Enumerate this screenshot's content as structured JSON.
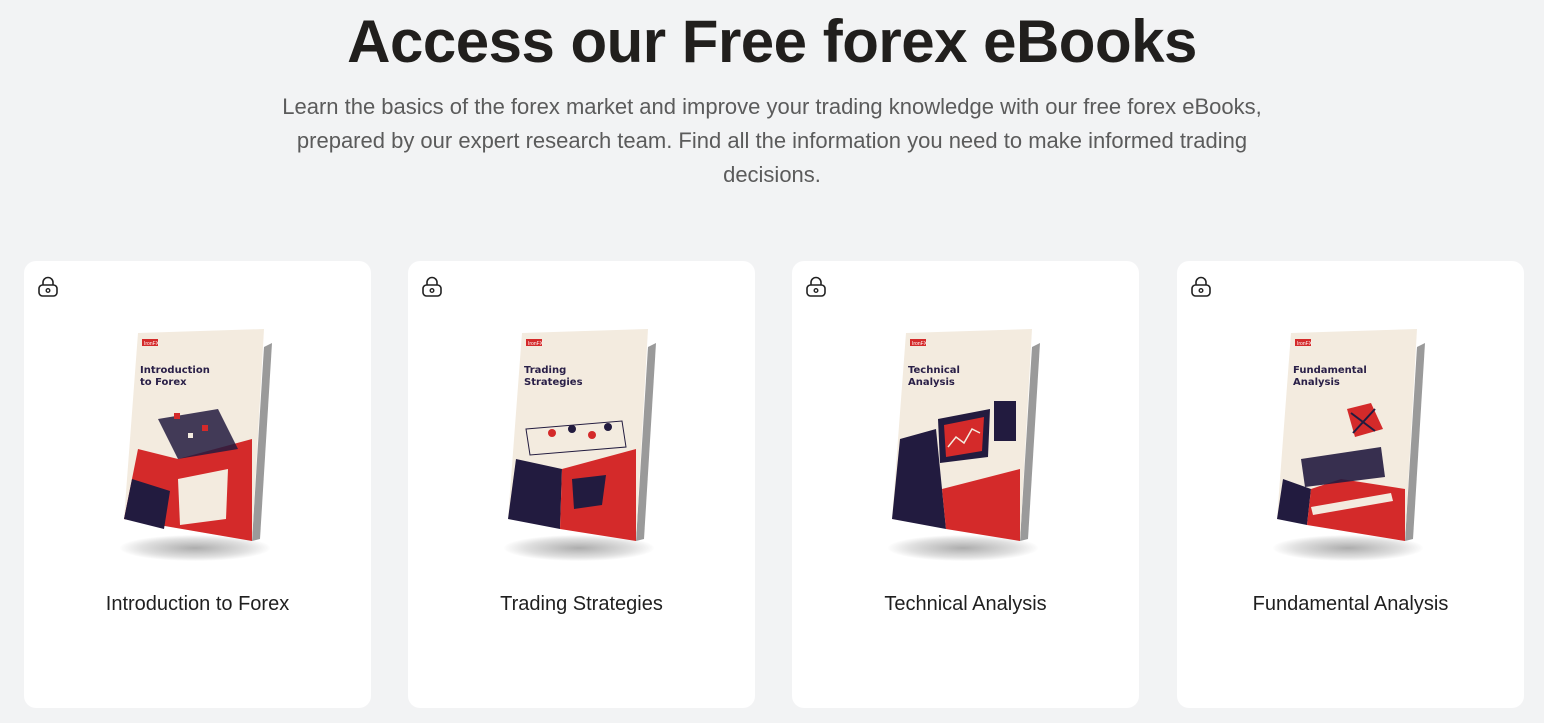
{
  "hero": {
    "title": "Access our Free forex eBooks",
    "subtitle": "Learn the basics of the forex market and improve your trading knowledge with our free forex eBooks, prepared by our expert research team. Find all the information you need to make informed trading decisions."
  },
  "theme": {
    "page_bg": "#f2f3f4",
    "card_bg": "#ffffff",
    "accent_red": "#d42a2a",
    "navy": "#221b3f",
    "cream": "#f3ebdf"
  },
  "ebooks": [
    {
      "title": "Introduction to Forex",
      "cover_line1": "Introduction",
      "cover_line2": "to Forex",
      "brand": "IronFX",
      "icon": "lock-icon"
    },
    {
      "title": "Trading Strategies",
      "cover_line1": "Trading",
      "cover_line2": "Strategies",
      "brand": "IronFX",
      "icon": "lock-icon"
    },
    {
      "title": "Technical Analysis",
      "cover_line1": "Technical",
      "cover_line2": "Analysis",
      "brand": "IronFX",
      "icon": "lock-icon"
    },
    {
      "title": "Fundamental Analysis",
      "cover_line1": "Fundamental",
      "cover_line2": "Analysis",
      "brand": "IronFX",
      "icon": "lock-icon"
    }
  ]
}
